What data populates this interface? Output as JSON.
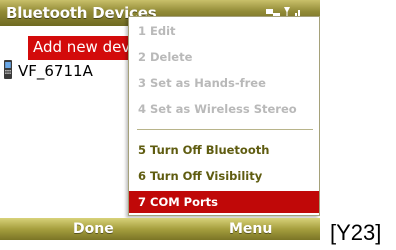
{
  "title_bar": {
    "title": "Bluetooth Devices",
    "icons": [
      "signal-icon",
      "network-icon"
    ]
  },
  "device_list": {
    "items": [
      {
        "label": "Add new device...",
        "selected": true
      },
      {
        "label": "VF_6711A",
        "icon": "phone-icon"
      }
    ]
  },
  "menu": {
    "items": [
      {
        "label": "1 Edit",
        "enabled": false
      },
      {
        "label": "2 Delete",
        "enabled": false
      },
      {
        "label": "3 Set as Hands-free",
        "enabled": false
      },
      {
        "label": "4 Set as Wireless Stereo",
        "enabled": false
      },
      {
        "label": "5 Turn Off Bluetooth",
        "enabled": true
      },
      {
        "label": "6 Turn Off Visibility",
        "enabled": true
      },
      {
        "label": "7 COM Ports",
        "enabled": true,
        "selected": true
      }
    ]
  },
  "softkeys": {
    "left": "Done",
    "right": "Menu"
  },
  "caption": "[Y23]",
  "colors": {
    "title_bar": "#918a36",
    "selection": "#d30b0b",
    "menu_selected": "#c00808",
    "menu_enabled_text": "#5f5c10",
    "menu_disabled_text": "#b9b9b9"
  }
}
